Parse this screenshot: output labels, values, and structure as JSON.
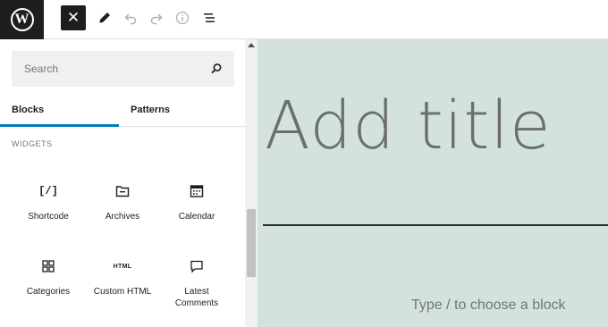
{
  "toolbar": {
    "logo_icon": "wordpress-logo",
    "logo_letter": "W",
    "close_icon": "close-icon",
    "close_glyph": "✕",
    "tools_icon": "pencil-icon",
    "undo_icon": "undo-icon",
    "redo_icon": "redo-icon",
    "details_icon": "info-icon",
    "list_view_icon": "list-view-icon"
  },
  "inserter": {
    "search": {
      "placeholder": "Search",
      "value": "",
      "icon": "search-icon"
    },
    "tabs": [
      {
        "label": "Blocks",
        "active": true
      },
      {
        "label": "Patterns",
        "active": false
      }
    ],
    "section_label": "WIDGETS",
    "blocks": [
      {
        "label": "Shortcode",
        "icon": "shortcode-icon",
        "glyph": "[/]"
      },
      {
        "label": "Archives",
        "icon": "archive-folder-icon"
      },
      {
        "label": "Calendar",
        "icon": "calendar-icon"
      },
      {
        "label": "Categories",
        "icon": "categories-grid-icon"
      },
      {
        "label": "Custom HTML",
        "icon": "html-icon",
        "glyph": "HTML"
      },
      {
        "label": "Latest Comments",
        "label_line1": "Latest",
        "label_line2": "Comments",
        "icon": "comment-icon"
      }
    ]
  },
  "editor": {
    "title_placeholder": "Add title",
    "block_placeholder": "Type / to choose a block",
    "canvas_color": "#d4e2dc"
  },
  "colors": {
    "accent": "#007cba",
    "dark": "#1e1e1e"
  }
}
